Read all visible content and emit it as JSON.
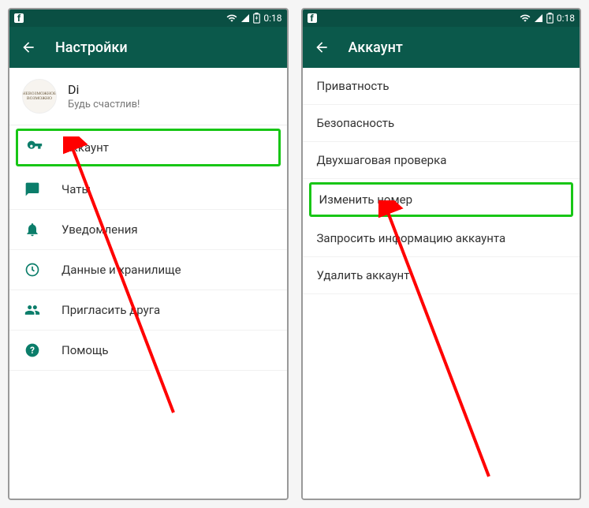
{
  "status": {
    "time": "0:18"
  },
  "left": {
    "title": "Настройки",
    "profile": {
      "name": "Di",
      "status": "Будь счастлив!",
      "avatar": "НЕВОЗМОЖНОЕ ВОЗМОЖНО"
    },
    "menu": {
      "account": "Аккаунт",
      "chats": "Чаты",
      "notifications": "Уведомления",
      "data": "Данные и хранилище",
      "invite": "Пригласить друга",
      "help": "Помощь"
    }
  },
  "right": {
    "title": "Аккаунт",
    "items": {
      "privacy": "Приватность",
      "security": "Безопасность",
      "twostep": "Двухшаговая проверка",
      "changenum": "Изменить номер",
      "requestinfo": "Запросить информацию аккаунта",
      "delete": "Удалить аккаунт"
    }
  }
}
